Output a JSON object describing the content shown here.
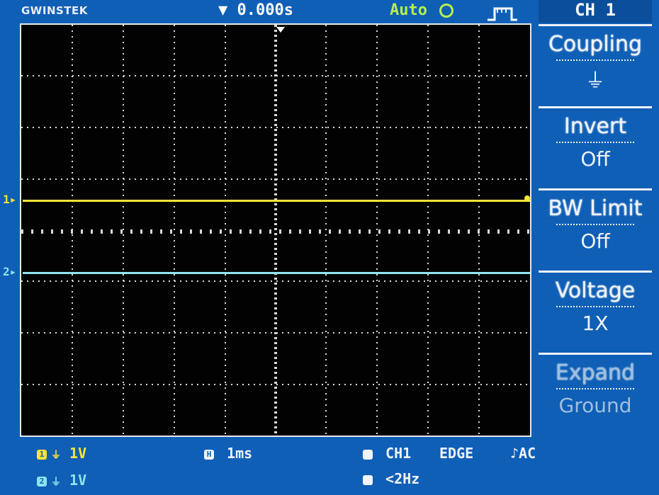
{
  "header": {
    "brand": "GWINSTEK",
    "trigger_position": "▼ 0.000s",
    "trigger_mode": "Auto",
    "channel_title": "CH 1"
  },
  "markers": {
    "ch1": "1",
    "ch2": "2"
  },
  "menu": {
    "coupling": {
      "label": "Coupling",
      "value": "⏚"
    },
    "invert": {
      "label": "Invert",
      "value": "Off"
    },
    "bw_limit": {
      "label": "BW Limit",
      "value": "Off"
    },
    "voltage": {
      "label": "Voltage",
      "value": "1X"
    },
    "expand": {
      "label": "Expand",
      "value": "Ground"
    }
  },
  "status": {
    "ch1_scale": "1V",
    "ch2_scale": "1V",
    "ch1_icon": "1",
    "ch2_icon": "2",
    "timebase_icon": "H",
    "timebase": "1ms",
    "trigger_source": "CH1",
    "trigger_type": "EDGE",
    "trigger_slope": "AC",
    "frequency": "<2Hz"
  },
  "colors": {
    "background": "#0f5fb6",
    "ch1": "#ffe43a",
    "ch2": "#8fe4f0",
    "screen": "#020202"
  }
}
